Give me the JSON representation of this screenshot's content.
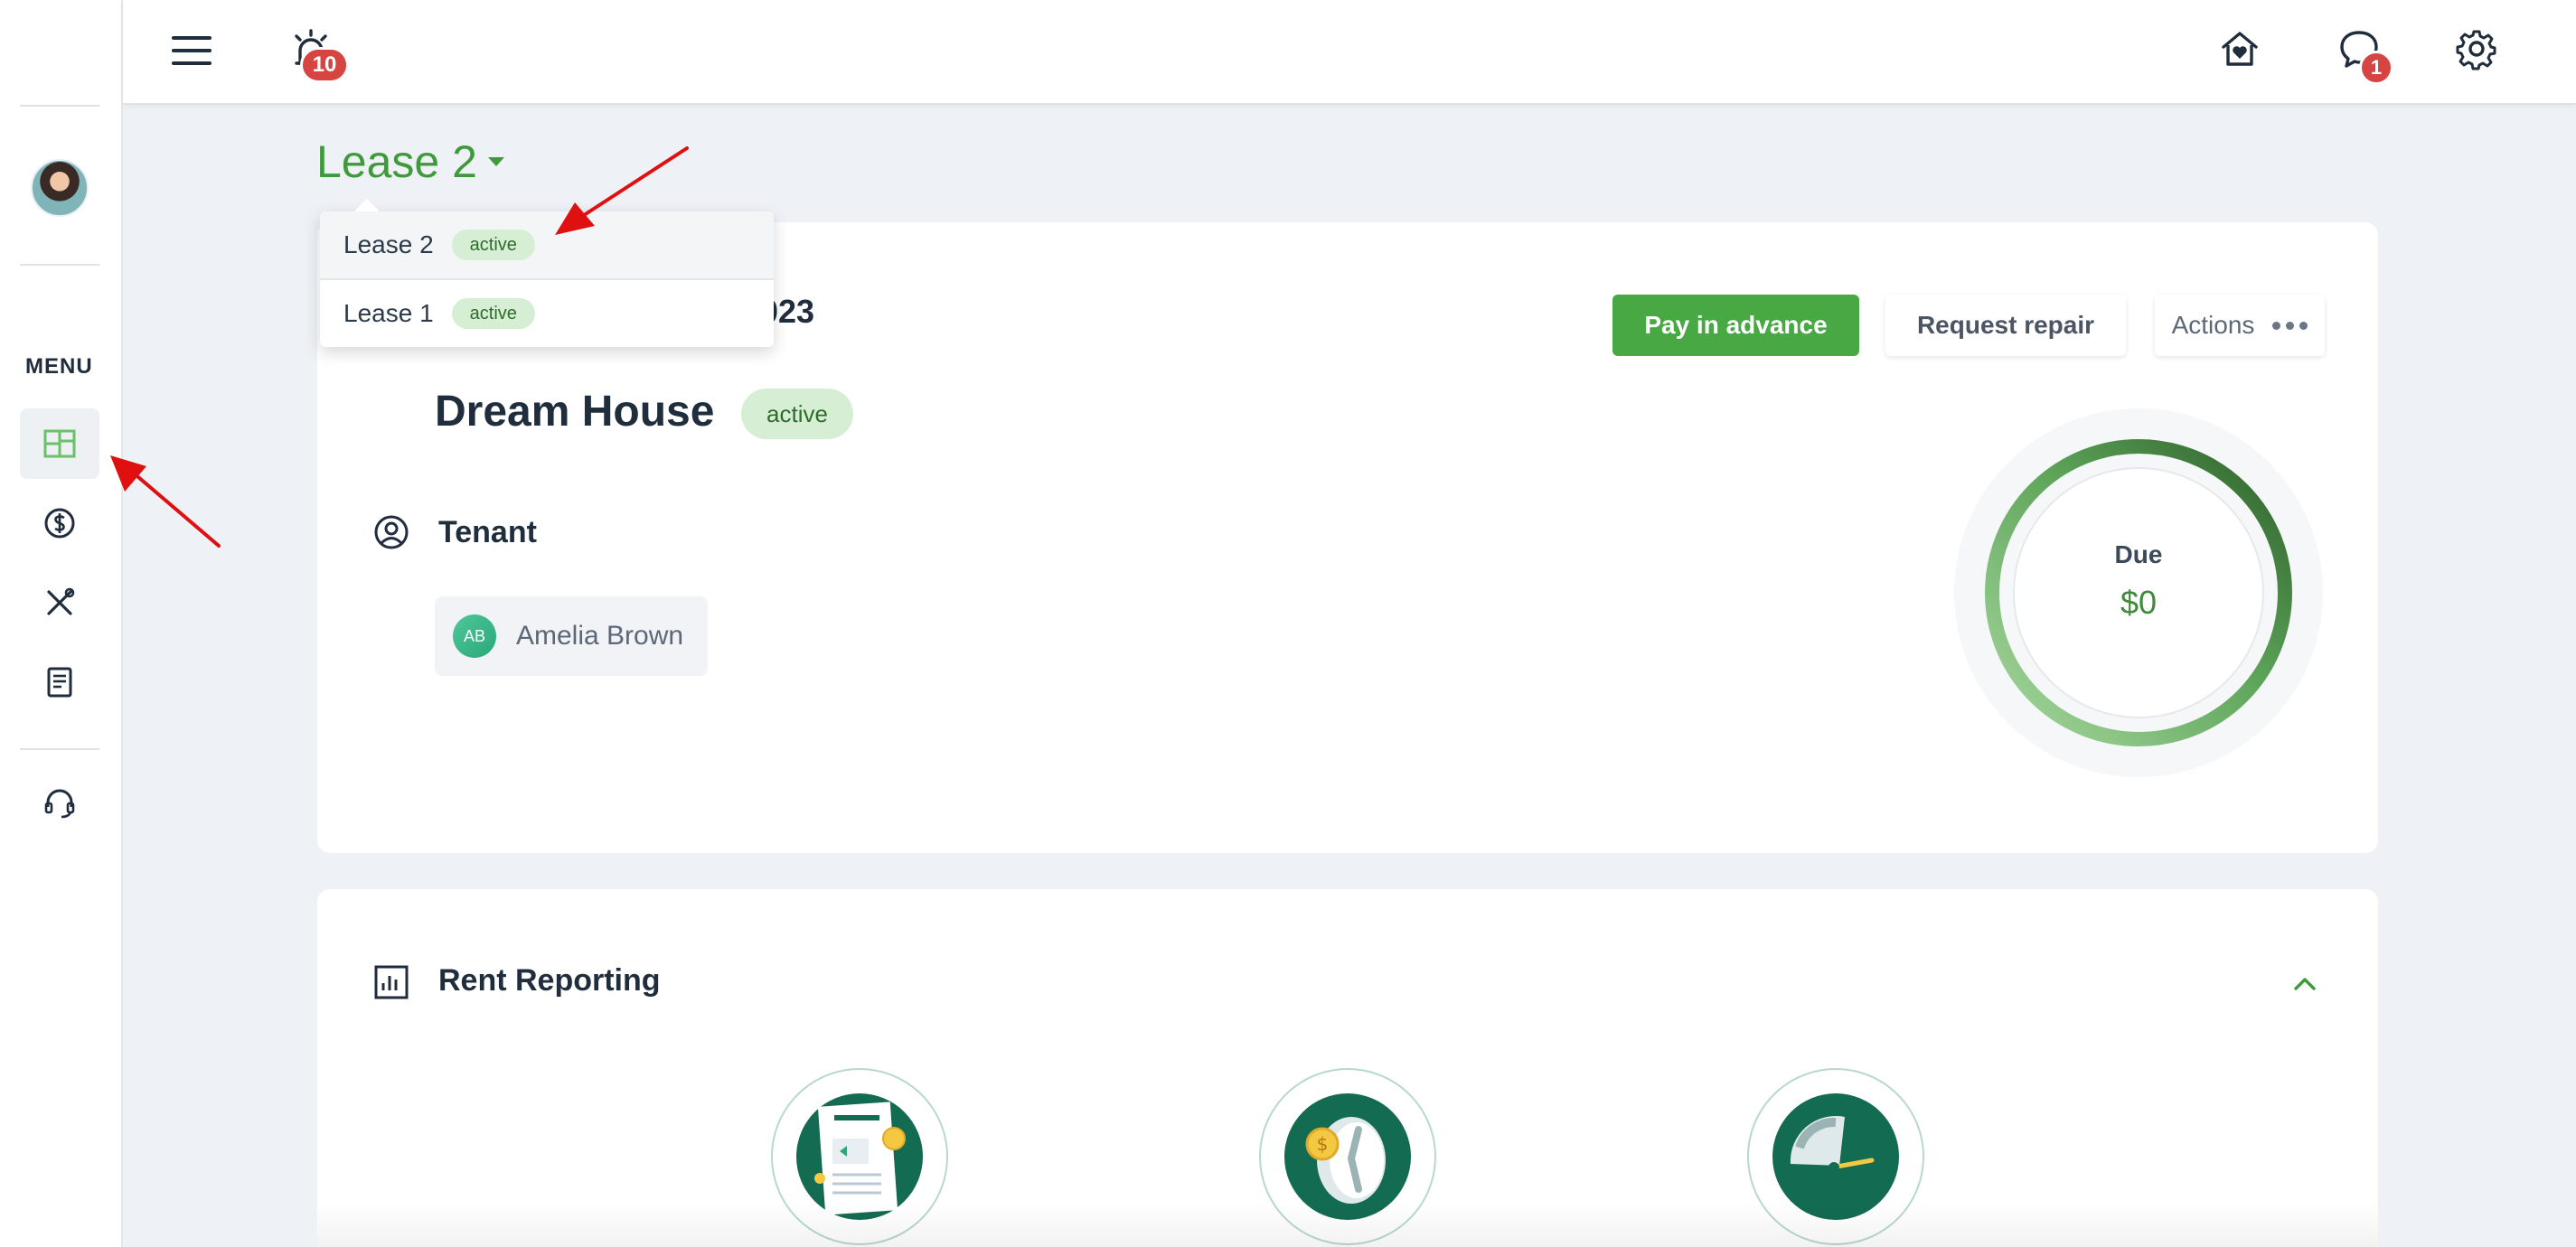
{
  "sidebar": {
    "menu_label": "MENU",
    "items": [
      {
        "name": "dashboard",
        "icon": "dashboard-icon",
        "active": true
      },
      {
        "name": "payments",
        "icon": "dollar-circle-icon"
      },
      {
        "name": "maintenance",
        "icon": "tools-icon"
      },
      {
        "name": "documents",
        "icon": "document-icon"
      },
      {
        "name": "support",
        "icon": "headset-icon"
      }
    ]
  },
  "topbar": {
    "alarm_badge": "10",
    "messages_badge": "1",
    "icons": [
      "hamburger-menu-icon",
      "alarm-icon",
      "home-heart-icon",
      "chat-bubble-icon",
      "gear-icon"
    ]
  },
  "lease_selector": {
    "current": "Lease 2",
    "options": [
      {
        "label": "Lease 2",
        "status": "active"
      },
      {
        "label": "Lease 1",
        "status": "active"
      }
    ]
  },
  "lease_card": {
    "partial_title": "023",
    "property_name": "Dream House",
    "property_status": "active",
    "tenant_heading": "Tenant",
    "tenant": {
      "initials": "AB",
      "name": "Amelia Brown"
    },
    "buttons": {
      "pay_advance": "Pay in advance",
      "request_repair": "Request repair",
      "actions": "Actions"
    },
    "due": {
      "label": "Due",
      "value": "$0"
    }
  },
  "rent_reporting": {
    "heading": "Rent Reporting"
  },
  "colors": {
    "brand_green": "#3f9a3b",
    "button_green": "#47a844",
    "pill_bg": "#d6eed4",
    "badge_red": "#d64541",
    "illustration_green": "#136b52",
    "annotation_red": "#e01010"
  }
}
